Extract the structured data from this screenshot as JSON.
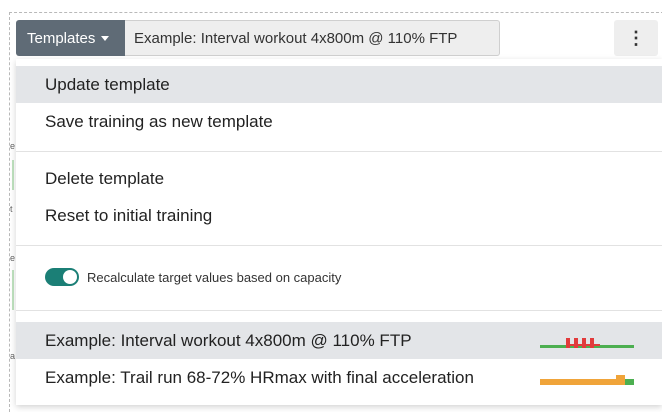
{
  "toolbar": {
    "templates_label": "Templates",
    "current_template": "Example: Interval workout 4x800m @ 110% FTP",
    "more_symbol": "⋮"
  },
  "menu": {
    "update_template": "Update template",
    "save_as_new": "Save training as new template",
    "delete_template": "Delete template",
    "reset_training": "Reset to initial training",
    "recalc_label": "Recalculate target values based on capacity",
    "recalc_enabled": true,
    "templates": [
      {
        "label": "Example: Interval workout 4x800m @ 110% FTP",
        "active": true
      },
      {
        "label": "Example: Trail run 68-72% HRmax with final acceleration",
        "active": false
      }
    ]
  },
  "colors": {
    "toggle_on": "#1b7f76",
    "zone_green": "#4caf50",
    "zone_red": "#e23b3b",
    "zone_orange": "#f0a43a"
  }
}
